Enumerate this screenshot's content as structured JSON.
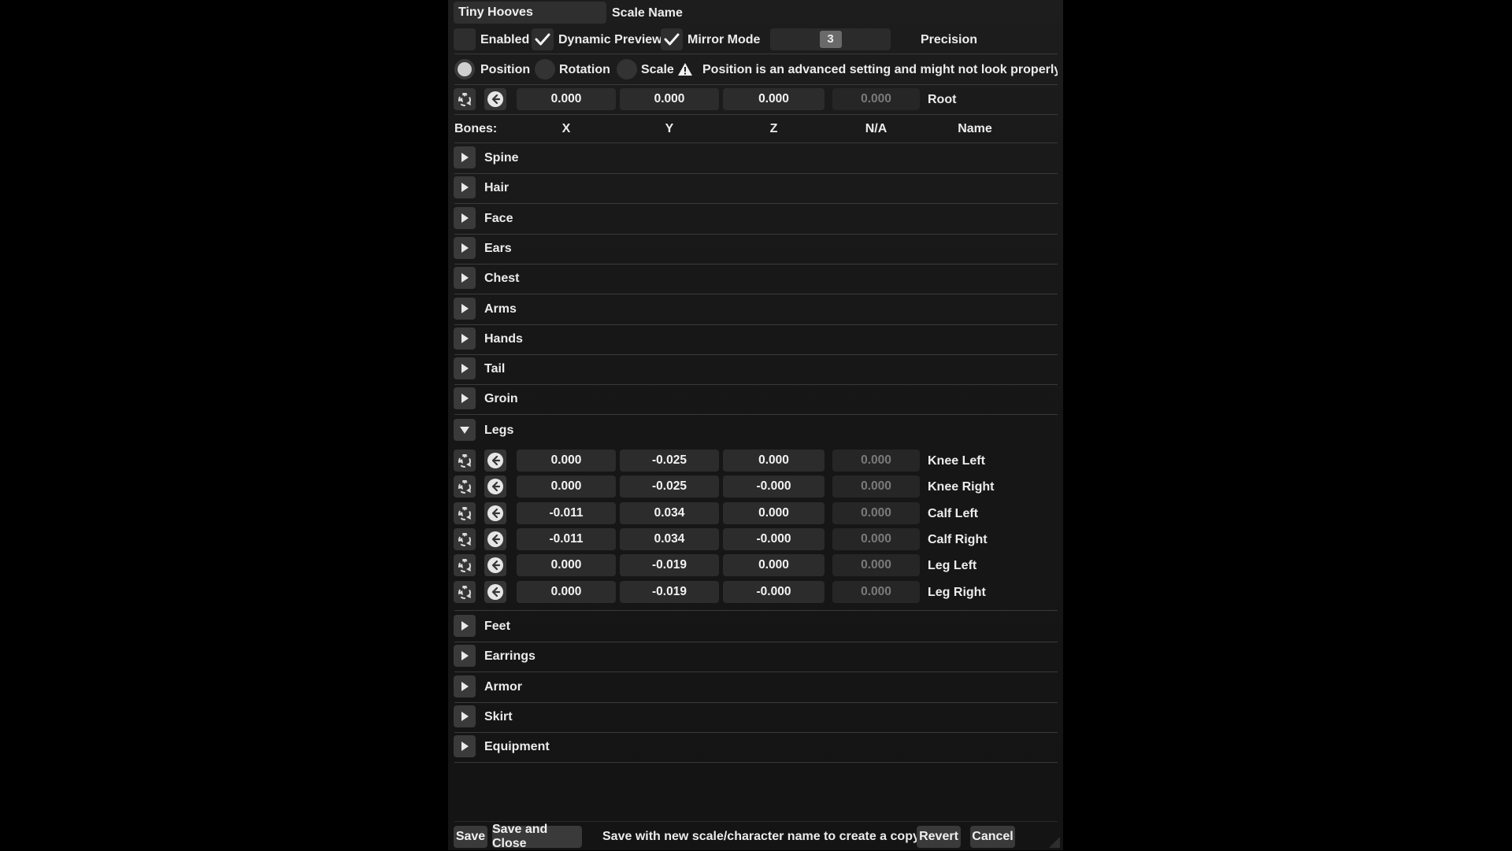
{
  "header": {
    "scale_name_value": "Tiny Hooves",
    "scale_name_label": "Scale Name",
    "enabled_label": "Enabled",
    "enabled_checked": false,
    "dynamic_preview_label": "Dynamic Preview",
    "dynamic_preview_checked": true,
    "mirror_mode_label": "Mirror Mode",
    "mirror_mode_checked": true,
    "precision_value": "3",
    "precision_label": "Precision"
  },
  "mode": {
    "options": [
      "Position",
      "Rotation",
      "Scale"
    ],
    "selected": "Position",
    "warning": "Position is an advanced setting and might not look properly with s"
  },
  "root_row": {
    "x": "0.000",
    "y": "0.000",
    "z": "0.000",
    "na": "0.000",
    "name": "Root"
  },
  "columns": {
    "bones": "Bones:",
    "x": "X",
    "y": "Y",
    "z": "Z",
    "na": "N/A",
    "name": "Name"
  },
  "groups_before": [
    "Spine",
    "Hair",
    "Face",
    "Ears",
    "Chest",
    "Arms",
    "Hands",
    "Tail",
    "Groin"
  ],
  "expanded_group": {
    "label": "Legs",
    "rows": [
      {
        "x": "0.000",
        "y": "-0.025",
        "z": "0.000",
        "na": "0.000",
        "name": "Knee Left"
      },
      {
        "x": "0.000",
        "y": "-0.025",
        "z": "-0.000",
        "na": "0.000",
        "name": "Knee Right"
      },
      {
        "x": "-0.011",
        "y": "0.034",
        "z": "0.000",
        "na": "0.000",
        "name": "Calf Left"
      },
      {
        "x": "-0.011",
        "y": "0.034",
        "z": "-0.000",
        "na": "0.000",
        "name": "Calf Right"
      },
      {
        "x": "0.000",
        "y": "-0.019",
        "z": "0.000",
        "na": "0.000",
        "name": "Leg Left"
      },
      {
        "x": "0.000",
        "y": "-0.019",
        "z": "-0.000",
        "na": "0.000",
        "name": "Leg Right"
      }
    ]
  },
  "groups_after": [
    "Feet",
    "Earrings",
    "Armor",
    "Skirt",
    "Equipment"
  ],
  "footer": {
    "save": "Save",
    "save_close": "Save and Close",
    "hint": "Save with new scale/character name to create a copy.",
    "revert": "Revert",
    "cancel": "Cancel"
  },
  "icons": {
    "reset": "recycle-icon",
    "revert": "arrow-left-circle-icon",
    "collapsed": "play-triangle-icon",
    "expanded": "triangle-down-icon",
    "warning": "warning-icon",
    "check": "checkmark-icon"
  }
}
